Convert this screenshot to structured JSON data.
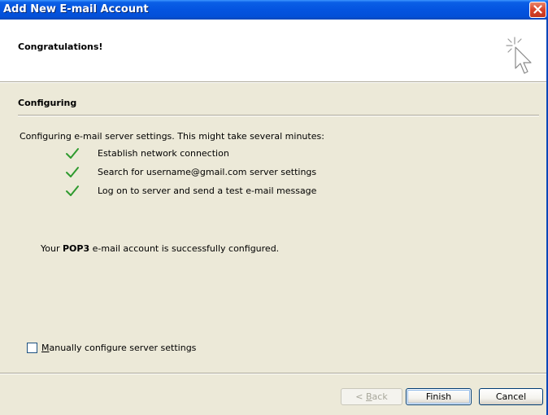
{
  "window": {
    "title": "Add New E-mail Account",
    "close_icon": "close-icon"
  },
  "header": {
    "title": "Congratulations!",
    "icon": "cursor-sparkle-icon"
  },
  "section": {
    "title": "Configuring",
    "intro": "Configuring e-mail server settings. This might take several minutes:",
    "steps": [
      {
        "label": "Establish network connection",
        "status": "done",
        "icon": "checkmark-icon"
      },
      {
        "label": "Search for username@gmail.com server settings",
        "status": "done",
        "icon": "checkmark-icon"
      },
      {
        "label": "Log on to server and send a test e-mail message",
        "status": "done",
        "icon": "checkmark-icon"
      }
    ],
    "success": {
      "prefix": "Your ",
      "protocol": "POP3",
      "suffix": " e-mail account is successfully configured."
    }
  },
  "manual": {
    "label_accel": "M",
    "label_rest": "anually configure server settings",
    "checked": false
  },
  "buttons": {
    "back": {
      "prefix": "< ",
      "accel": "B",
      "rest": "ack",
      "enabled": false
    },
    "finish": {
      "label": "Finish",
      "default": true
    },
    "cancel": {
      "label": "Cancel"
    }
  },
  "colors": {
    "title_bar": "#0454e0",
    "window_bg": "#ece9d8",
    "check_green": "#2e9a2e",
    "close_red": "#d9442b"
  }
}
